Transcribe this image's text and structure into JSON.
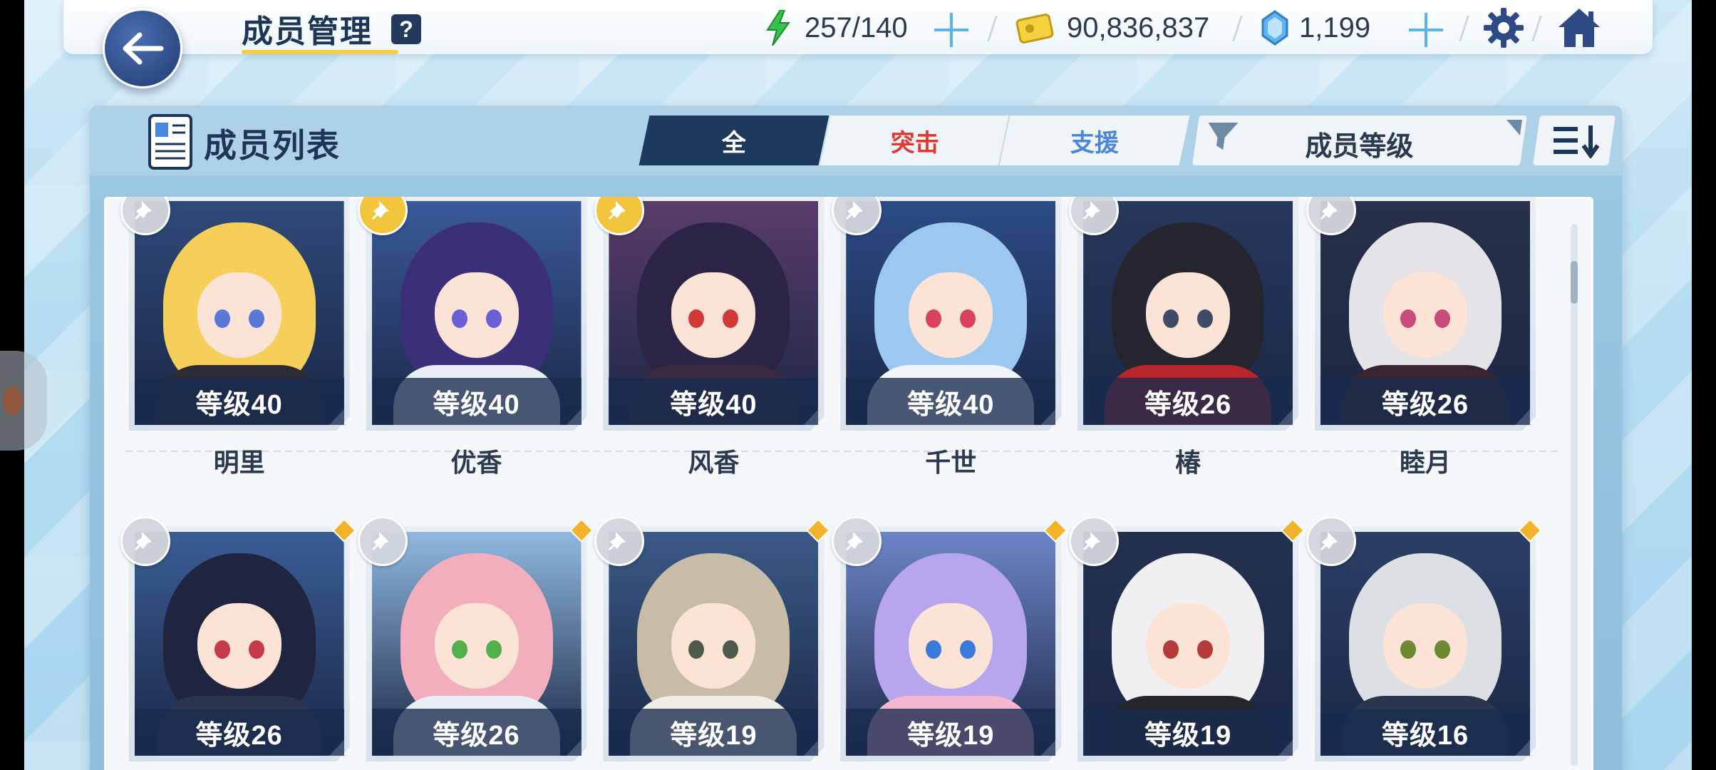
{
  "header": {
    "title": "成员管理",
    "help_label": "?",
    "energy": "257/140",
    "credits": "90,836,837",
    "gems": "1,199"
  },
  "panel": {
    "title": "成员列表",
    "tabs": [
      {
        "label": "全",
        "active": true
      },
      {
        "label": "突击",
        "active": false,
        "color": "#e0392f"
      },
      {
        "label": "支援",
        "active": false,
        "color": "#4a86dd"
      }
    ],
    "sort_label": "成员等级"
  },
  "members": [
    {
      "name": "明里",
      "level": "等级40",
      "hair": "#f6cf5a",
      "eye": "#5a78d6",
      "outfit": "#2b2b36",
      "bg": "#2f4a7a",
      "pin": "gray"
    },
    {
      "name": "优香",
      "level": "等级40",
      "hair": "#3c2f7a",
      "eye": "#6a5fd6",
      "outfit": "#e9eef6",
      "bg": "#3a5a9a",
      "pin": "gold"
    },
    {
      "name": "风香",
      "level": "等级40",
      "hair": "#2b2447",
      "eye": "#d23a3a",
      "outfit": "#3a2a40",
      "bg": "#5a3c6a",
      "pin": "gold"
    },
    {
      "name": "千世",
      "level": "等级40",
      "hair": "#9cc8ef",
      "eye": "#d8435a",
      "outfit": "#f1f5fa",
      "bg": "#2c4b86",
      "pin": "gray"
    },
    {
      "name": "椿",
      "level": "等级26",
      "hair": "#24252e",
      "eye": "#3f4a66",
      "outfit": "#b8262c",
      "bg": "#27385c",
      "pin": "gray"
    },
    {
      "name": "睦月",
      "level": "等级26",
      "hair": "#e4e4e8",
      "eye": "#c94a7c",
      "outfit": "#3a2430",
      "bg": "#28304a",
      "pin": "gray"
    },
    {
      "name": "",
      "level": "等级26",
      "hair": "#1f2440",
      "eye": "#c43a4a",
      "outfit": "#2c3550",
      "bg": "#3a5d96",
      "pin": "gray"
    },
    {
      "name": "",
      "level": "等级26",
      "hair": "#f3aebd",
      "eye": "#52b14a",
      "outfit": "#e9eef6",
      "bg": "#8fb9e0",
      "pin": "gray"
    },
    {
      "name": "",
      "level": "等级19",
      "hair": "#c8bca9",
      "eye": "#4f5b4a",
      "outfit": "#f0ede6",
      "bg": "#3b5a86",
      "pin": "gray"
    },
    {
      "name": "",
      "level": "等级19",
      "hair": "#b7a6ee",
      "eye": "#3b7ad6",
      "outfit": "#f3b7cf",
      "bg": "#6d86c8",
      "pin": "gray"
    },
    {
      "name": "",
      "level": "等级19",
      "hair": "#f0f0f2",
      "eye": "#b53a3a",
      "outfit": "#25252c",
      "bg": "#23314f",
      "pin": "gray"
    },
    {
      "name": "",
      "level": "等级16",
      "hair": "#dcdfe3",
      "eye": "#6b8a32",
      "outfit": "#2a3650",
      "bg": "#2b3f66",
      "pin": "gray"
    }
  ]
}
